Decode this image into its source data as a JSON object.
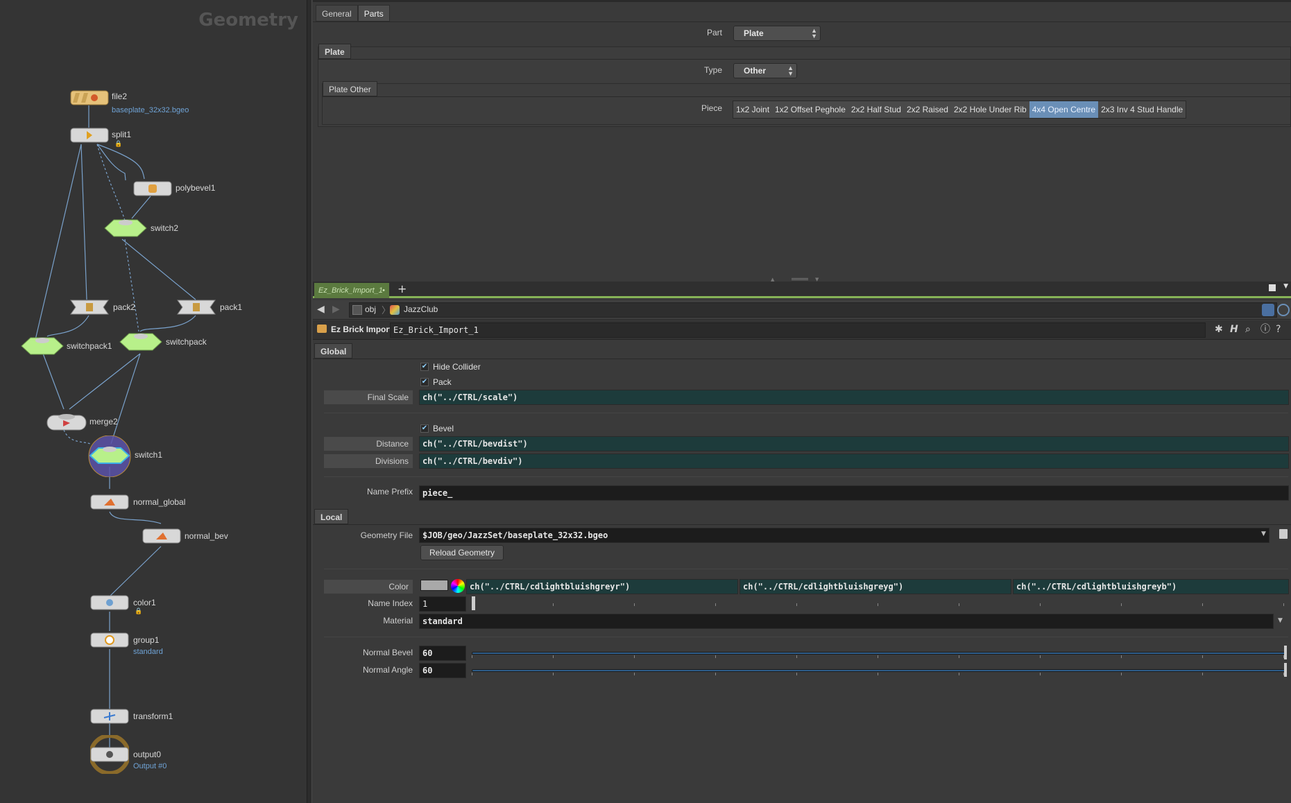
{
  "network": {
    "title": "Geometry",
    "nodes": {
      "file2": {
        "label": "file2",
        "sub": "baseplate_32x32.bgeo"
      },
      "split1": {
        "label": "split1"
      },
      "polybevel1": {
        "label": "polybevel1"
      },
      "switch2": {
        "label": "switch2"
      },
      "pack2": {
        "label": "pack2"
      },
      "pack1": {
        "label": "pack1"
      },
      "switchpack1": {
        "label": "switchpack1"
      },
      "switchpack": {
        "label": "switchpack"
      },
      "merge2": {
        "label": "merge2"
      },
      "switch1": {
        "label": "switch1"
      },
      "normal_global": {
        "label": "normal_global"
      },
      "normal_bev": {
        "label": "normal_bev"
      },
      "color1": {
        "label": "color1"
      },
      "group1": {
        "label": "group1",
        "sub": "standard"
      },
      "transform1": {
        "label": "transform1"
      },
      "output0": {
        "label": "output0",
        "sub": "Output #0"
      }
    }
  },
  "upper": {
    "tabs": [
      "General",
      "Parts"
    ],
    "part_label": "Part",
    "part_value": "Plate",
    "plate_section": "Plate",
    "type_label": "Type",
    "type_value": "Other",
    "plate_other_section": "Plate Other",
    "piece_label": "Piece",
    "pieces": [
      "1x2 Joint",
      "1x2 Offset Peghole",
      "2x2 Half Stud",
      "2x2 Raised",
      "2x2 Hole Under Rib",
      "4x4 Open Centre",
      "2x3 Inv 4 Stud Handle"
    ],
    "selected_piece": "4x4 Open Centre"
  },
  "lower": {
    "pane_tab": "Ez_Brick_Import_1",
    "add_tab": "+",
    "path": [
      "obj",
      "JazzClub"
    ],
    "node_type": "Ez Brick Import",
    "node_name": "Ez_Brick_Import_1",
    "global_tab": "Global",
    "hide_collider": {
      "label": "Hide Collider",
      "checked": true
    },
    "pack": {
      "label": "Pack",
      "checked": true
    },
    "final_scale": {
      "label": "Final Scale",
      "value": "ch(\"../CTRL/scale\")"
    },
    "bevel": {
      "label": "Bevel",
      "checked": true
    },
    "distance": {
      "label": "Distance",
      "value": "ch(\"../CTRL/bevdist\")"
    },
    "divisions": {
      "label": "Divisions",
      "value": "ch(\"../CTRL/bevdiv\")"
    },
    "name_prefix": {
      "label": "Name Prefix",
      "value": "piece_"
    },
    "local_tab": "Local",
    "geometry_file": {
      "label": "Geometry File",
      "value": "$JOB/geo/JazzSet/baseplate_32x32.bgeo"
    },
    "reload_button": "Reload Geometry",
    "color": {
      "label": "Color",
      "r": "ch(\"../CTRL/cdlightbluishgreyr\")",
      "g": "ch(\"../CTRL/cdlightbluishgreyg\")",
      "b": "ch(\"../CTRL/cdlightbluishgreyb\")",
      "swatch": "#a9a9a9"
    },
    "name_index": {
      "label": "Name Index",
      "value": "1"
    },
    "material": {
      "label": "Material",
      "value": "standard"
    },
    "normal_bevel": {
      "label": "Normal Bevel",
      "value": "60"
    },
    "normal_angle": {
      "label": "Normal Angle",
      "value": "60"
    }
  },
  "colors": {
    "accent_green": "#86b357",
    "selected_blue": "#6a8fb7",
    "field_teal": "#1d3b3b",
    "link_blue": "#6fa3d6"
  }
}
